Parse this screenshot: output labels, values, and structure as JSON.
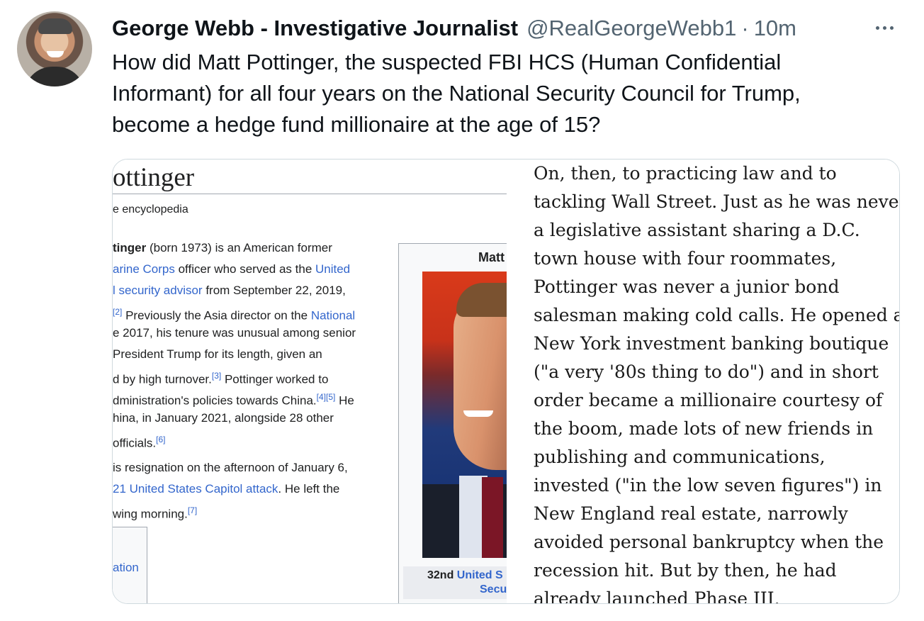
{
  "tweet": {
    "display_name": "George Webb - Investigative Journalist",
    "handle": "@RealGeorgeWebb1",
    "separator": "·",
    "time": "10m",
    "text": "How did Matt Pottinger, the suspected FBI HCS (Human Confidential\nInformant) for all four years on the National Security Council for Trump,\nbecome a hedge fund millionaire at the age of 15?"
  },
  "icons": {
    "more": "more-horizontal-icon",
    "avatar": "profile-photo"
  },
  "wiki": {
    "title": "ottinger",
    "subtitle": "e encyclopedia",
    "lines": [
      {
        "a": "tinger",
        "b": " (born 1973) is an American former",
        "bold": true
      },
      {
        "a": "arine Corps",
        "b": " officer who served as the ",
        "c": "United",
        "link_a": true
      },
      {
        "a": "l security advisor",
        "b": " from September 22, 2019,",
        "link_a": true
      },
      {
        "sup": "[2]",
        "b": " Previously the Asia director on the ",
        "c": "National"
      },
      {
        "b": "e 2017, his tenure was unusual among senior"
      },
      {
        "b": "President Trump for its length, given an"
      },
      {
        "b": "d by high turnover.",
        "sup2": "[3]",
        "d": " Pottinger worked to"
      },
      {
        "b": "dministration's policies towards China.",
        "sup2": "[4][5]",
        "d": " He"
      },
      {
        "b": "hina, in January 2021, alongside 28 other"
      },
      {
        "b": " officials.",
        "sup2": "[6]"
      },
      {
        "b": "is resignation on the afternoon of January 6,",
        "gap": true
      },
      {
        "a": "21 United States Capitol attack",
        "b": ". He left the",
        "link_a": true
      },
      {
        "b": "wing morning.",
        "sup2": "[7]"
      }
    ],
    "box_label": "ation",
    "infobox_name": "Matt",
    "caption_1a": "32nd ",
    "caption_1b": "United S",
    "caption_2": "Secu"
  },
  "article_lines": [
    "On, then, to practicing law and to",
    "tackling Wall Street. Just as he was never",
    "a legislative assistant sharing a D.C.",
    "town house with four roommates,",
    "Pottinger was never a junior bond",
    "salesman making cold calls. He opened a",
    "New York investment banking boutique",
    "(\"a very '80s thing to do\") and in short",
    "order became a millionaire courtesy of",
    "the boom, made lots of new friends in",
    "publishing and communications,",
    "invested (\"in the low seven figures\") in",
    "New England real estate, narrowly",
    "avoided personal bankruptcy when the",
    "recession hit. But by then, he had",
    "already launched Phase III."
  ]
}
